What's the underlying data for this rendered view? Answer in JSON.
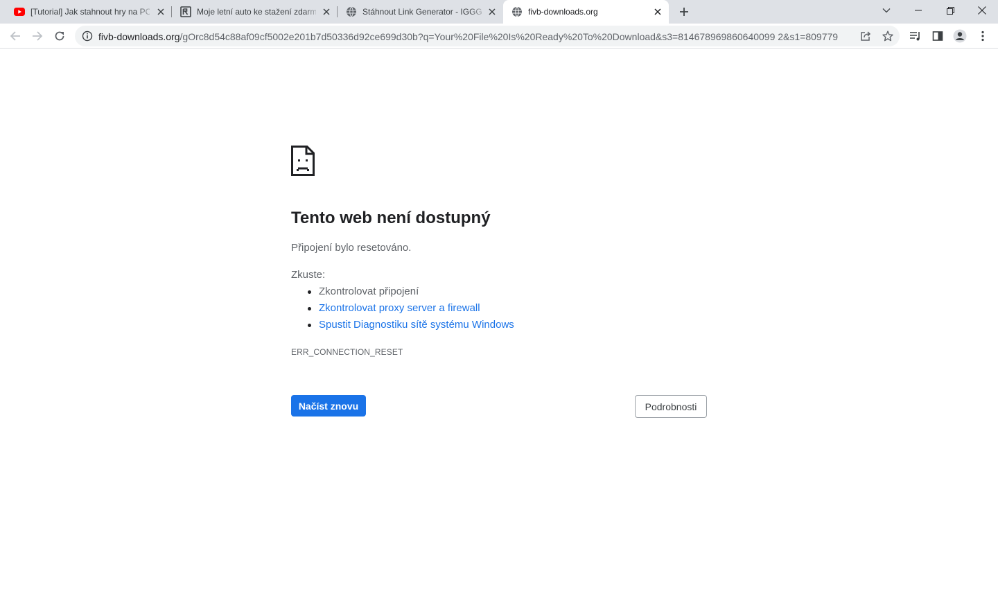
{
  "browser": {
    "tabs": [
      {
        "title": "[Tutorial] Jak stahnout hry na PC",
        "favicon": "youtube-icon",
        "active": false
      },
      {
        "title": "Moje letní auto ke stažení zdarma",
        "favicon": "site-logo-icon",
        "active": false
      },
      {
        "title": "Stáhnout Link Generator - IGGGAMES",
        "favicon": "globe-icon",
        "active": false
      },
      {
        "title": "fivb-downloads.org",
        "favicon": "globe-icon",
        "active": true
      }
    ],
    "address": {
      "host": "fivb-downloads.org",
      "path": "/gOrc8d54c88af09cf5002e201b7d50336d92ce699d30b?q=Your%20File%20Is%20Ready%20To%20Download&s3=814678969860640099 2&s1=809779"
    }
  },
  "error_page": {
    "title": "Tento web není dostupný",
    "subtitle": "Připojení bylo resetováno.",
    "try_label": "Zkuste:",
    "suggestions": [
      "Zkontrolovat připojení",
      "Zkontrolovat proxy server a firewall",
      "Spustit Diagnostiku sítě systému Windows"
    ],
    "error_code": "ERR_CONNECTION_RESET",
    "reload_button": "Načíst znovu",
    "details_button": "Podrobnosti"
  },
  "colors": {
    "accent": "#1a73e8",
    "tabstrip": "#dee1e6",
    "youtube_red": "#ff0000"
  }
}
